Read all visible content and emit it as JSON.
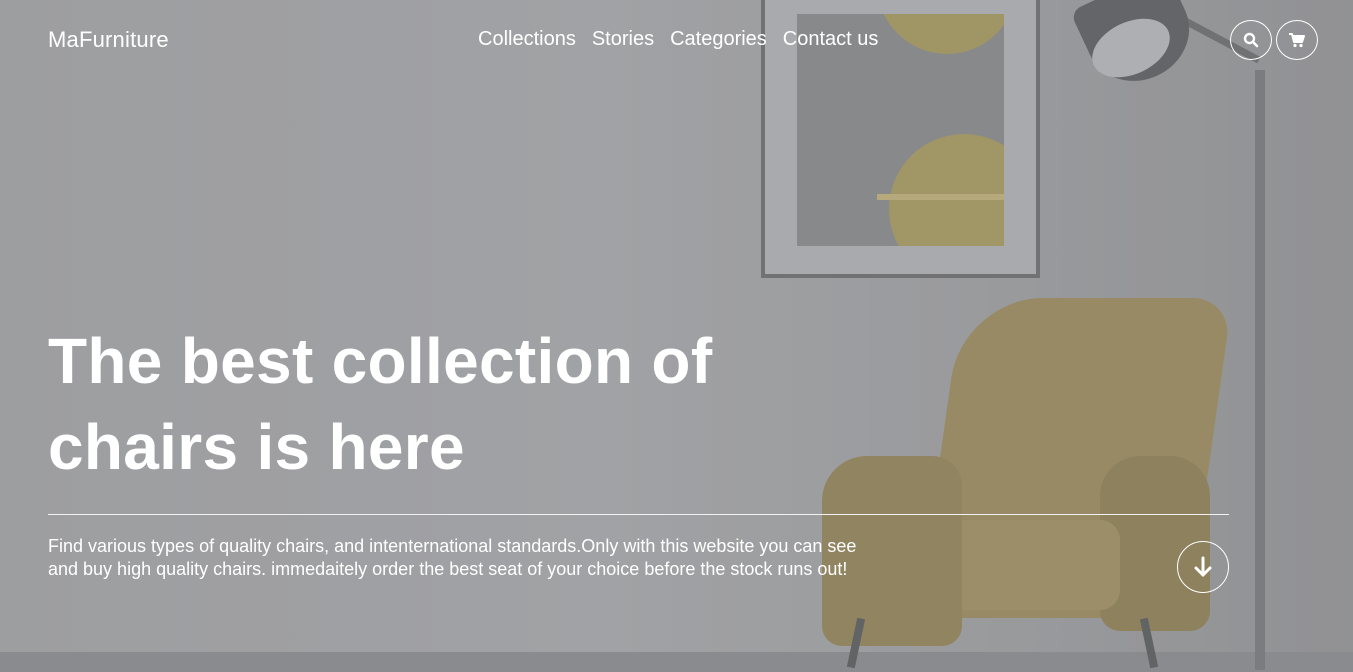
{
  "header": {
    "brand": "MaFurniture",
    "nav": [
      {
        "label": "Collections"
      },
      {
        "label": "Stories"
      },
      {
        "label": "Categories"
      },
      {
        "label": "Contact us"
      }
    ],
    "icons": {
      "search": "search-icon",
      "cart": "cart-icon"
    }
  },
  "hero": {
    "headline": "The best collection of chairs is here",
    "description": "Find various types of quality chairs, and intenternational standards.Only with this website you can see and buy high quality chairs. immedaitely order the best seat of your choice before the stock runs out!",
    "scroll_icon": "arrow-down-icon"
  },
  "colors": {
    "text": "#ffffff",
    "background": "#a4a5a7",
    "chair": "#9d8d5e"
  }
}
